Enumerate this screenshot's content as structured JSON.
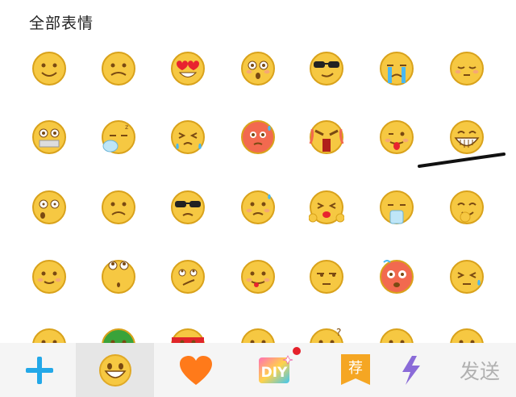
{
  "header": {
    "title": "全部表情"
  },
  "emoji_rows": [
    [
      "smile-icon",
      "worried-icon",
      "heart-eyes-icon",
      "surprised-icon",
      "sunglasses-icon",
      "crying-icon",
      "shy-icon"
    ],
    [
      "zipped-mouth-icon",
      "sleepy-icon",
      "sweat-squint-icon",
      "angry-red-icon",
      "furious-icon",
      "tongue-out-icon",
      "grin-icon"
    ],
    [
      "startled-icon",
      "sad-icon",
      "cool-frown-icon",
      "nervous-sweat-icon",
      "pleading-icon",
      "vomit-icon",
      "laugh-cover-icon"
    ],
    [
      "blush-icon",
      "eyes-up-icon",
      "smirk-icon",
      "drool-icon",
      "unamused-icon",
      "dizzy-angry-icon",
      "speechless-sweat-icon"
    ],
    [
      "partial-emoji-icon",
      "green-emoji-icon",
      "headband-emoji-icon",
      "partial-emoji-icon",
      "question-emoji-icon",
      "partial-emoji-icon",
      "partial-emoji-icon"
    ]
  ],
  "toolbar": {
    "tabs": [
      {
        "name": "add-tab",
        "icon": "plus-icon"
      },
      {
        "name": "emoji-tab",
        "icon": "smiley-icon",
        "selected": true
      },
      {
        "name": "favorites-tab",
        "icon": "heart-icon"
      },
      {
        "name": "diy-tab",
        "icon": "diy-icon",
        "label": "DIY",
        "badge": true
      },
      {
        "name": "recommend-tab",
        "icon": "bookmark-icon",
        "label": "荐"
      },
      {
        "name": "more-tab",
        "icon": "lightning-icon"
      }
    ],
    "send_label": "发送"
  },
  "colors": {
    "face": "#f6c842",
    "face_outline": "#d9a21b",
    "accent_blue": "#23a8e8",
    "heart": "#ff7a1a",
    "badge": "#e5202a",
    "recommend": "#f5a623"
  }
}
